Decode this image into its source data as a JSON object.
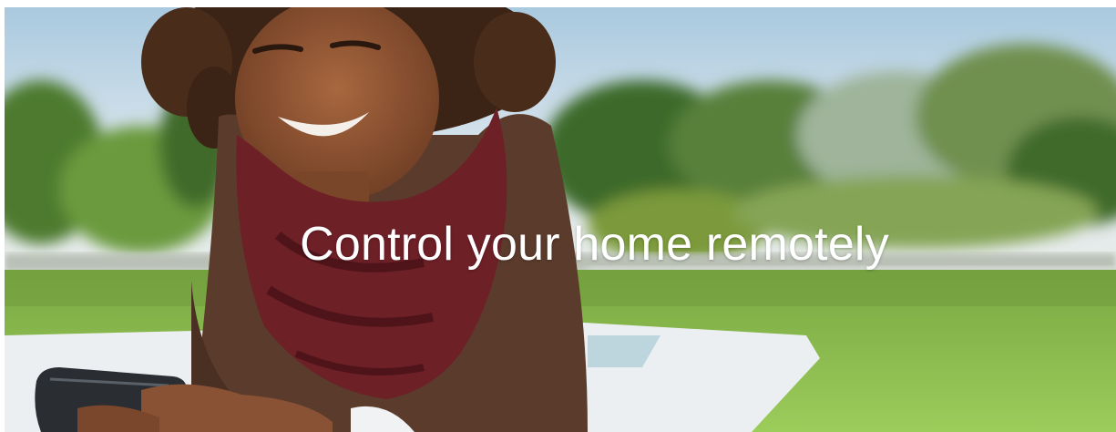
{
  "hero": {
    "headline": "Control your home remotely"
  },
  "colors": {
    "headline_text": "#ffffff",
    "sky": "#cfe0ea",
    "grass": "#8fbe4f",
    "trees": "#4f7a34",
    "sweater": "#5a3a2c",
    "scarf": "#6e1f26",
    "skin": "#8a5234",
    "blanket": "#e9ecef"
  }
}
